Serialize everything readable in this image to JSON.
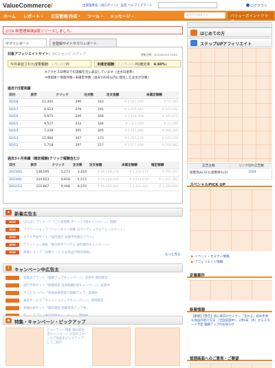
{
  "header": {
    "logo": "ValueCommerce",
    "logo_slash": "/",
    "links": "出管理者名（再ログイン） 設定 ヘルプ | スマート",
    "search_placeholder": "",
    "logout": "ログアウト"
  },
  "nav": {
    "items": [
      "ホーム",
      "レポート・",
      "広告管理/作成・",
      "ツール・",
      "メッセージ・"
    ],
    "search_placeholder": "広告主を検索する",
    "bp": "バリューポイントクラブ"
  },
  "notice": "2/19 新管理画面β版リリースしました。",
  "tabs": [
    "サマリレポート",
    "全登録サイトサマリレポート"
  ],
  "summary": {
    "target_label": "対象アフィリエイトサイト：",
    "target_value": "VCショッピ メクッブ",
    "updated": "更新日時：2013/02/19 15:00",
    "this_month_label": "今月承認された成果報酬：",
    "this_month_value": "176,000",
    "this_month_unit": "円",
    "unconfirmed_label": "未確定報酬：",
    "unconfirmed_value": "2,275,941",
    "unconfirmed_unit": "円",
    "rate_label": "(確定率：",
    "rate_value": "4.60%",
    "rate_close": ")",
    "note1": "※アクセス日時日での実績を元に表記しています（注文日基準）",
    "note2": "※保留率＝保留件数÷未確定件数（過去100日以内に発生した注文が対象）"
  },
  "daily": {
    "title": "過去7日間実績",
    "headers": [
      "日付",
      "表示",
      "クリック",
      "注文数",
      "注文金額",
      "未確定報酬"
    ],
    "rows": [
      [
        "02/18",
        "11,441",
        "296",
        "142",
        "¥ 2,541,009",
        "¥ 19,283"
      ],
      [
        "02/17",
        "6,023",
        "278",
        "191",
        "¥ 1,975,412",
        "¥ 125,162"
      ],
      [
        "02/16",
        "6,875",
        "240",
        "166",
        "¥ 2,114,308",
        "¥ 140,871"
      ],
      [
        "02/15",
        "9,527",
        "333",
        "184",
        "¥ 1,8 3,018",
        "¥ 11,049"
      ],
      [
        "02/14",
        "7,239",
        "305",
        "205",
        "¥ 2,441,880",
        "¥ 166,300"
      ],
      [
        "02/13",
        "11,466",
        "307",
        "173",
        "¥ 2,065,170",
        "¥ 122,129"
      ],
      [
        "02/12",
        "5,718",
        "297",
        "217",
        "¥ 1,677,839",
        "¥ 108,882"
      ]
    ]
  },
  "monthly": {
    "title": "過去3ヶ月実績（確定報酬(クリック報酬含む)）",
    "headers": [
      "日付",
      "表示",
      "クリック",
      "注文数",
      "注文金額",
      "未確定報酬",
      "確定報酬"
    ],
    "rows": [
      [
        "2013/02",
        "138,595",
        "5,273",
        "3,419",
        "¥ 40,158,178",
        "¥ 2,333,117",
        "¥ 195,307"
      ],
      [
        "2013/01",
        "224,653",
        "9,618",
        "5,573",
        "¥ 71,248,100",
        "¥ 2,511,018",
        "¥ 1,212,301"
      ],
      [
        "2012/12",
        "215,867",
        "9,048",
        "6,570",
        "¥ 65,920,000",
        "¥ 2,101,001",
        "¥ 3,190,000"
      ]
    ]
  },
  "new_advertisers": {
    "title": "新着広告主",
    "tag": "NEW",
    "items": [
      "ぱらぽシプリメント「ご入会特典 ポイント3倍キャンペーン」開催！",
      "フラワーショップ「バレンタイン特集 ロマンティックなアレンジメント」",
      "ホテル予約サイト「国内旅行 早期予約割引プラン」",
      "ファッション通販「春の新作アイテム 送料無料キャンペーン」",
      "家電ショップ「決算セール 人気商品が特別価格」"
    ],
    "more": "もっと見る"
  },
  "campaigns": {
    "title": "キャンペーン中広告主",
    "items": [
      "化粧品ブランド「報酬アップキャンペーン」実施中 期間限定",
      "旅行予約サイト「期間限定 成果報酬2倍キャンペーン」実施中",
      "ネットスーパー「新規会員登録で報酬アップ」実施中",
      "通信サービス「キャッシュバックキャンペーン」期間限定",
      "保険比較サイト「無料相談 報酬単価アップ中」",
      "ゲームアプリ「事前登録キャンペーン」開催中"
    ]
  },
  "features": {
    "title": "特集・キャンペーン・ピックアップ",
    "text": "ビューティー特集 春の新生活キャンペーン 人気のスキンケア商品をピックアップしてご紹介"
  },
  "right": {
    "hajime": "はじめての方",
    "stepup": "ステップUPアフィリエイト",
    "adv_header": "広告主数",
    "link_header": "リンク切れ広告数",
    "adv_label": "提携済み",
    "adv_value": "303",
    "pending_label": "提携待ち",
    "pending_value": "0",
    "link_value": "1029",
    "special": "スペシャルPICK UP",
    "event1": "イベント・セミナー情報",
    "event2": "アフィリエイト情報",
    "regular": "定番案件",
    "news": "新着情報",
    "news_text": "【重要】【警告】初心者向けセミナー「売れる」初め手頃な商品の紹介方法 （全国実施中）、2月6日（水）からスタート予定 報酬アップのお知らせ",
    "inquiry": "管理画面へのご意見・ご要望"
  },
  "colors": {
    "accent": "#f08a24",
    "link": "#2a5db0",
    "alert": "#d02020",
    "new_tag": "#e55a1f",
    "campaign_tag": "#e8731c"
  }
}
